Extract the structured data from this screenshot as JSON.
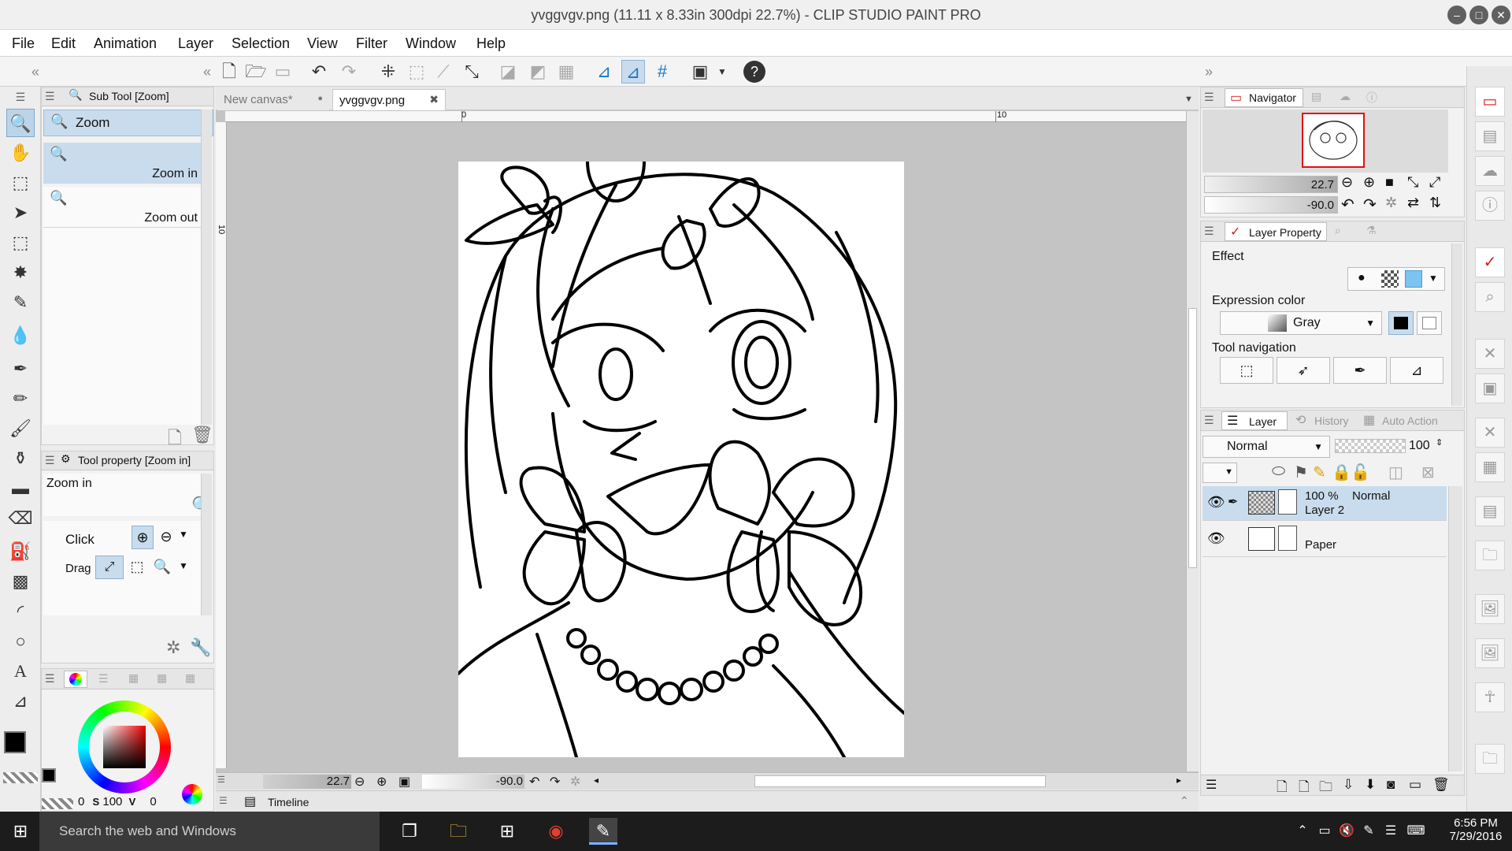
{
  "window": {
    "title": "yvggvgv.png (11.11 x 8.33in 300dpi 22.7%)  - CLIP STUDIO PAINT PRO"
  },
  "menu": [
    "File",
    "Edit",
    "Animation",
    "Layer",
    "Selection",
    "View",
    "Filter",
    "Window",
    "Help"
  ],
  "subtool": {
    "header": "Sub Tool [Zoom]",
    "group_label": "Zoom",
    "items": [
      "Zoom in",
      "Zoom out"
    ]
  },
  "toolprop": {
    "header": "Tool property [Zoom in]",
    "current": "Zoom in",
    "click_label": "Click",
    "drag_label": "Drag"
  },
  "color": {
    "r_val": "0",
    "s_label": "S",
    "s_val": "100",
    "v_label": "V",
    "v_val": "0",
    "main_color": "#000000",
    "sub_color": "#ffffff"
  },
  "documents": {
    "tabs": [
      {
        "label": "New canvas*",
        "active": false
      },
      {
        "label": "yvggvgv.png",
        "active": true
      }
    ],
    "ruler_marks": [
      "0",
      "10",
      "10"
    ]
  },
  "canvas_status": {
    "zoom": "22.7",
    "rotation": "-90.0"
  },
  "timeline": {
    "label": "Timeline"
  },
  "navigator": {
    "tab": "Navigator",
    "zoom": "22.7",
    "rotation": "-90.0"
  },
  "layer_property": {
    "tab": "Layer Property",
    "effect_label": "Effect",
    "expression_label": "Expression color",
    "expression_value": "Gray",
    "tool_nav_label": "Tool navigation",
    "accent_color": "#7cc4f0"
  },
  "layer_panel": {
    "tabs": [
      "Layer",
      "History",
      "Auto Action"
    ],
    "blend_mode": "Normal",
    "opacity": "100",
    "layers": [
      {
        "percent": "100 %",
        "mode": "Normal",
        "name": "Layer 2",
        "selected": true
      },
      {
        "percent": "",
        "mode": "",
        "name": "Paper",
        "selected": false
      }
    ]
  },
  "taskbar": {
    "search_placeholder": "Search the web and Windows",
    "time": "6:56 PM",
    "date": "7/29/2016"
  }
}
